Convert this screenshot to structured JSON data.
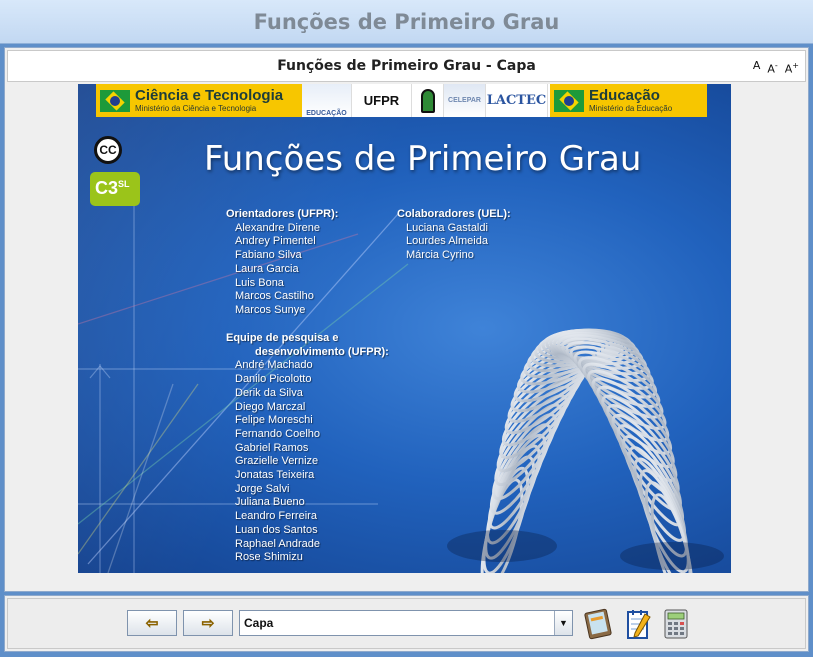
{
  "window": {
    "title": "Funções de Primeiro Grau"
  },
  "content": {
    "header_title": "Funções de Primeiro Grau - Capa",
    "font_buttons": {
      "normal": "A",
      "decrease": "A",
      "decrease_mark": "-",
      "increase": "A",
      "increase_mark": "+"
    }
  },
  "slide": {
    "logos": {
      "ciencia_title": "Ciência e Tecnologia",
      "ciencia_sub": "Ministério da Ciência e Tecnologia",
      "educacao_mark": "EDUCAÇÃO",
      "ufpr": "UFPR",
      "celepar": "CELEPAR",
      "lactec": "LACTEC",
      "educacao_title": "Educação",
      "educacao_sub": "Ministério da Educação"
    },
    "cc_badge": "CC",
    "c3sl_main": "C3",
    "c3sl_sup": "SL",
    "title": "Funções de Primeiro Grau",
    "orientadores_heading": "Orientadores (UFPR):",
    "orientadores": [
      "Alexandre Direne",
      "Andrey Pimentel",
      "Fabiano Silva",
      "Laura Garcia",
      "Luis Bona",
      "Marcos Castilho",
      "Marcos Sunye"
    ],
    "colaboradores_heading": "Colaboradores (UEL):",
    "colaboradores": [
      "Luciana Gastaldi",
      "Lourdes Almeida",
      "Márcia Cyrino"
    ],
    "equipe_heading_line1": "Equipe de pesquisa e",
    "equipe_heading_line2": "desenvolvimento (UFPR):",
    "equipe": [
      "André Machado",
      "Danilo Picolotto",
      "Derik da Silva",
      "Diego Marczal",
      "Felipe Moreschi",
      "Fernando Coelho",
      "Gabriel Ramos",
      "Grazielle Vernize",
      "Jonatas Teixeira",
      "Jorge Salvi",
      "Juliana Bueno",
      "Leandro Ferreira",
      "Luan dos Santos",
      "Raphael Andrade",
      "Rose Shimizu"
    ]
  },
  "navigation": {
    "prev_icon": "arrow-left-icon",
    "next_icon": "arrow-right-icon",
    "current_page": "Capa",
    "tools": [
      "book-icon",
      "notepad-icon",
      "calculator-icon"
    ]
  },
  "colors": {
    "slide_blue": "#2162bd",
    "gov_yellow": "#f7c600",
    "c3sl_green": "#9bc41a"
  }
}
